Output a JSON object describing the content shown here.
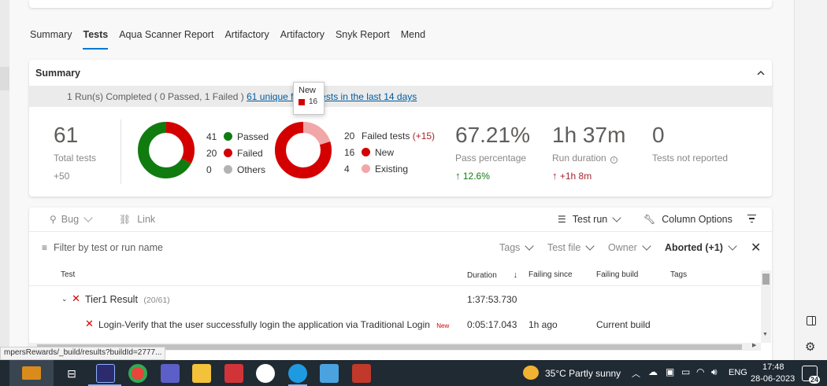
{
  "tabs": [
    "Summary",
    "Tests",
    "Aqua Scanner Report",
    "Artifactory",
    "Artifactory",
    "Snyk Report",
    "Mend"
  ],
  "active_tab": "Tests",
  "summary": {
    "title": "Summary",
    "runs_text": "1 Run(s) Completed ( 0 Passed, 1 Failed ) ",
    "runs_link": "61 unique failing tests in the last 14 days",
    "total_tests": "61",
    "total_tests_label": "Total tests",
    "total_delta": "+50",
    "outcome_legend": [
      {
        "count": "41",
        "label": "Passed",
        "color": "#107c10"
      },
      {
        "count": "20",
        "label": "Failed",
        "color": "#d40000"
      },
      {
        "count": "0",
        "label": "Others",
        "color": "#b3b3b3"
      }
    ],
    "outcome_chart": {
      "passed": 41,
      "failed": 20,
      "others": 0
    },
    "failed_legend": [
      {
        "count": "20",
        "label": "Failed tests",
        "extra": "(+15)",
        "color": ""
      },
      {
        "count": "16",
        "label": "New",
        "extra": "",
        "color": "#d40000"
      },
      {
        "count": "4",
        "label": "Existing",
        "extra": "",
        "color": "#f1a7a7"
      }
    ],
    "failed_chart": {
      "new": 16,
      "existing": 4
    },
    "tooltip": {
      "title": "New",
      "value": "16"
    },
    "pass_percentage": "67.21%",
    "pass_percentage_label": "Pass percentage",
    "pass_delta": "12.6%",
    "run_duration": "1h 37m",
    "run_duration_label": "Run duration",
    "run_delta": "+1h 8m",
    "not_reported": "0",
    "not_reported_label": "Tests not reported"
  },
  "toolbar": {
    "bug": "Bug",
    "link": "Link",
    "test_run": "Test run",
    "column_options": "Column Options"
  },
  "filter": {
    "placeholder": "Filter by test or run name",
    "tags": "Tags",
    "test_file": "Test file",
    "owner": "Owner",
    "outcome": "Aborted (+1)"
  },
  "columns": {
    "test": "Test",
    "duration": "Duration",
    "failing_since": "Failing since",
    "failing_build": "Failing build",
    "tags": "Tags"
  },
  "rows": [
    {
      "name": "Tier1 Result",
      "count": "(20/61)",
      "duration": "1:37:53.730",
      "failing_since": "",
      "failing_build": "",
      "badge": ""
    },
    {
      "name": "Login-Verify that the user successfully login the application via Traditional Login",
      "count": "",
      "duration": "0:05:17.043",
      "failing_since": "1h ago",
      "failing_build": "Current build",
      "badge": "New"
    }
  ],
  "url_tip": "mpersRewards/_build/results?buildId=2777...",
  "taskbar": {
    "weather": "35°C  Partly sunny",
    "lang": "ENG",
    "time": "17:48",
    "date": "28-06-2023",
    "notifications": "24"
  }
}
